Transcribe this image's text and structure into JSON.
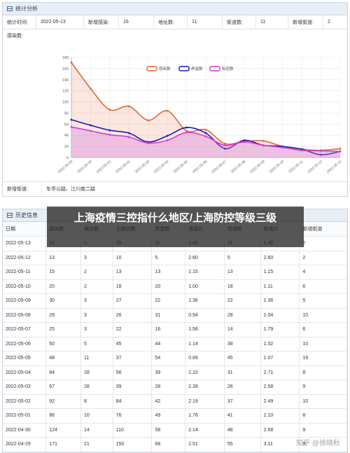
{
  "stats_panel": {
    "title": "统计分析",
    "info": [
      {
        "label": "统计时间:",
        "value": "2022-05-13"
      },
      {
        "label": "新增感染:",
        "value": "16"
      },
      {
        "label": "地址数:",
        "value": "11"
      },
      {
        "label": "街道数:",
        "value": "11"
      },
      {
        "label": "新增街道:",
        "value": "2"
      }
    ],
    "chart_title": "感染数:",
    "new_streets_label": "新增街道:",
    "new_streets_value": "车亭公路、江川南二路"
  },
  "chart_data": {
    "type": "line",
    "x": [
      "2022-04-29",
      "2022-04-30",
      "2022-05-01",
      "2022-05-02",
      "2022-05-03",
      "2022-05-04",
      "2022-05-05",
      "2022-05-06",
      "2022-05-07",
      "2022-05-08",
      "2022-05-09",
      "2022-05-10",
      "2022-05-11",
      "2022-05-12",
      "2022-05-13"
    ],
    "x_ticks": [
      "2022-04-29",
      "2022-04-30",
      "2022-05-01",
      "2022-05-02",
      "2022-05-03",
      "2022-05-04",
      "2022-05-05",
      "2022-05-06",
      "2022-05-07",
      "2022-05-08",
      "2022-05-09",
      "2022-05-10",
      "2022-05-11",
      "2022-05-12",
      "2022-05-13"
    ],
    "ylim": [
      0,
      180
    ],
    "yticks": [
      0,
      20,
      40,
      60,
      80,
      100,
      120,
      140,
      160,
      180
    ],
    "series": [
      {
        "name": "感染数",
        "color": "#e06a3b",
        "fill": "rgba(240,160,130,0.25)",
        "values": [
          171,
          124,
          86,
          92,
          67,
          84,
          48,
          50,
          25,
          29,
          30,
          20,
          15,
          13,
          16
        ]
      },
      {
        "name": "弄堂数",
        "color": "#1a1ab8",
        "fill": "rgba(0,0,0,0)",
        "values": [
          68,
          58,
          49,
          44,
          28,
          39,
          54,
          44,
          16,
          31,
          22,
          20,
          15,
          5,
          11
        ]
      },
      {
        "name": "街道数",
        "color": "#d63ad6",
        "fill": "rgba(210,120,220,0.35)",
        "values": [
          55,
          48,
          41,
          37,
          26,
          31,
          45,
          38,
          22,
          28,
          22,
          18,
          13,
          12,
          11
        ]
      }
    ],
    "legend_position": "top-center",
    "grid": true
  },
  "history_panel": {
    "title": "历史信息",
    "columns": [
      "日期",
      "感染数",
      "确诊数",
      "无症状数",
      "弄堂数",
      "感染比",
      "街道数",
      "街道比",
      "新增街道"
    ],
    "rows": [
      [
        "2022-05-13",
        "16",
        "1",
        "15",
        "11",
        "1.45",
        "11",
        "1.45",
        "2"
      ],
      [
        "2022-05-12",
        "13",
        "3",
        "10",
        "5",
        "2.60",
        "5",
        "2.60",
        "2"
      ],
      [
        "2022-05-11",
        "15",
        "2",
        "13",
        "13",
        "1.15",
        "13",
        "1.15",
        "4"
      ],
      [
        "2022-05-10",
        "20",
        "2",
        "18",
        "20",
        "1.00",
        "18",
        "1.11",
        "6"
      ],
      [
        "2022-05-09",
        "30",
        "3",
        "27",
        "22",
        "1.36",
        "22",
        "1.36",
        "5"
      ],
      [
        "2022-05-08",
        "29",
        "3",
        "26",
        "31",
        "0.94",
        "28",
        "1.04",
        "10"
      ],
      [
        "2022-05-07",
        "25",
        "3",
        "22",
        "16",
        "1.56",
        "14",
        "1.79",
        "6"
      ],
      [
        "2022-05-06",
        "50",
        "5",
        "45",
        "44",
        "1.14",
        "38",
        "1.32",
        "10"
      ],
      [
        "2022-05-05",
        "48",
        "11",
        "37",
        "54",
        "0.89",
        "45",
        "1.07",
        "19"
      ],
      [
        "2022-05-04",
        "84",
        "28",
        "56",
        "39",
        "2.15",
        "31",
        "2.71",
        "8"
      ],
      [
        "2022-05-03",
        "67",
        "28",
        "39",
        "28",
        "2.39",
        "26",
        "2.58",
        "9"
      ],
      [
        "2022-05-02",
        "92",
        "8",
        "84",
        "42",
        "2.19",
        "37",
        "2.49",
        "10"
      ],
      [
        "2022-05-01",
        "86",
        "10",
        "76",
        "49",
        "1.76",
        "41",
        "2.10",
        "8"
      ],
      [
        "2022-04-30",
        "124",
        "14",
        "110",
        "58",
        "2.14",
        "48",
        "2.58",
        "9"
      ],
      [
        "2022-04-29",
        "171",
        "21",
        "150",
        "68",
        "2.51",
        "55",
        "3.11",
        "9"
      ]
    ]
  },
  "overlay_title": "上海疫情三控指什么地区/上海防控等级三级",
  "watermark": "知乎 @徐晓秋"
}
